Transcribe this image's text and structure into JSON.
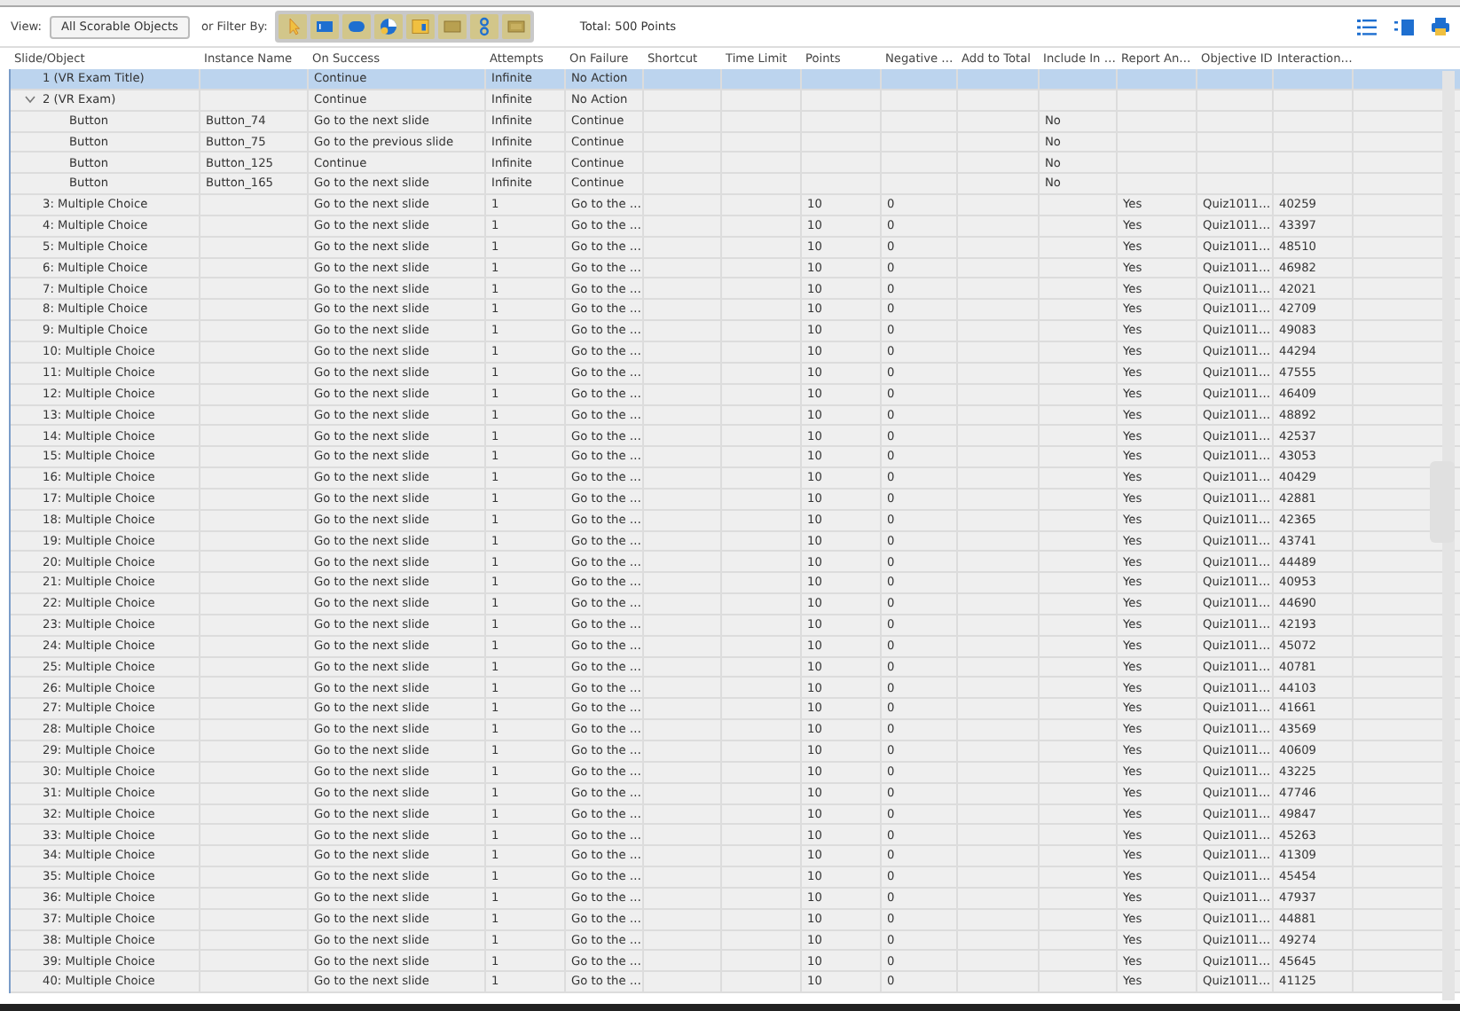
{
  "toolbar": {
    "view_label": "View:",
    "view_button": "All Scorable Objects",
    "filter_label": "or Filter By:",
    "filters": [
      {
        "kind": "cursor"
      },
      {
        "kind": "textbox"
      },
      {
        "kind": "button"
      },
      {
        "kind": "rollover"
      },
      {
        "kind": "question"
      },
      {
        "kind": "panel"
      },
      {
        "kind": "chain"
      },
      {
        "kind": "box"
      }
    ],
    "total": "Total: 500 Points"
  },
  "table": {
    "columns": [
      "Slide/Object",
      "Instance Name",
      "On Success",
      "Attempts",
      "On Failure",
      "Shortcut",
      "Time Limit",
      "Points",
      "Negative …",
      "Add to Total",
      "Include In …",
      "Report An…",
      "Objective ID",
      "Interaction…"
    ],
    "rows": [
      {
        "slide": "1 (VR Exam Title)",
        "on_success": "Continue",
        "attempts": "Infinite",
        "on_failure": "No Action",
        "selected": true
      },
      {
        "slide": "2 (VR Exam)",
        "on_success": "Continue",
        "attempts": "Infinite",
        "on_failure": "No Action",
        "selected": false,
        "expanded": true,
        "children": [
          {
            "slide": "Button",
            "instance": "Button_74",
            "on_success": "Go to the next slide",
            "attempts": "Infinite",
            "on_failure": "Continue",
            "include_in": "No",
            "selected": false
          },
          {
            "slide": "Button",
            "instance": "Button_75",
            "on_success": "Go to the previous slide",
            "attempts": "Infinite",
            "on_failure": "Continue",
            "include_in": "No",
            "selected": false
          },
          {
            "slide": "Button",
            "instance": "Button_125",
            "on_success": "Continue",
            "attempts": "Infinite",
            "on_failure": "Continue",
            "include_in": "No",
            "selected": false
          },
          {
            "slide": "Button",
            "instance": "Button_165",
            "on_success": "Go to the next slide",
            "attempts": "Infinite",
            "on_failure": "Continue",
            "include_in": "No",
            "selected": false
          }
        ]
      },
      {
        "slide": "3: Multiple Choice",
        "on_success": "Go to the next slide",
        "attempts": "1",
        "on_failure": "Go to the …",
        "points": "10",
        "negative": "0",
        "report": "Yes",
        "objective": "Quiz1011…",
        "interaction": "40259",
        "selected": false
      },
      {
        "slide": "4: Multiple Choice",
        "on_success": "Go to the next slide",
        "attempts": "1",
        "on_failure": "Go to the …",
        "points": "10",
        "negative": "0",
        "report": "Yes",
        "objective": "Quiz1011…",
        "interaction": "43397",
        "selected": false
      },
      {
        "slide": "5: Multiple Choice",
        "on_success": "Go to the next slide",
        "attempts": "1",
        "on_failure": "Go to the …",
        "points": "10",
        "negative": "0",
        "report": "Yes",
        "objective": "Quiz1011…",
        "interaction": "48510",
        "selected": false
      },
      {
        "slide": "6: Multiple Choice",
        "on_success": "Go to the next slide",
        "attempts": "1",
        "on_failure": "Go to the …",
        "points": "10",
        "negative": "0",
        "report": "Yes",
        "objective": "Quiz1011…",
        "interaction": "46982",
        "selected": false
      },
      {
        "slide": "7: Multiple Choice",
        "on_success": "Go to the next slide",
        "attempts": "1",
        "on_failure": "Go to the …",
        "points": "10",
        "negative": "0",
        "report": "Yes",
        "objective": "Quiz1011…",
        "interaction": "42021",
        "selected": false
      },
      {
        "slide": "8: Multiple Choice",
        "on_success": "Go to the next slide",
        "attempts": "1",
        "on_failure": "Go to the …",
        "points": "10",
        "negative": "0",
        "report": "Yes",
        "objective": "Quiz1011…",
        "interaction": "42709",
        "selected": false
      },
      {
        "slide": "9: Multiple Choice",
        "on_success": "Go to the next slide",
        "attempts": "1",
        "on_failure": "Go to the …",
        "points": "10",
        "negative": "0",
        "report": "Yes",
        "objective": "Quiz1011…",
        "interaction": "49083",
        "selected": false
      },
      {
        "slide": "10: Multiple Choice",
        "on_success": "Go to the next slide",
        "attempts": "1",
        "on_failure": "Go to the …",
        "points": "10",
        "negative": "0",
        "report": "Yes",
        "objective": "Quiz1011…",
        "interaction": "44294",
        "selected": false
      },
      {
        "slide": "11: Multiple Choice",
        "on_success": "Go to the next slide",
        "attempts": "1",
        "on_failure": "Go to the …",
        "points": "10",
        "negative": "0",
        "report": "Yes",
        "objective": "Quiz1011…",
        "interaction": "47555",
        "selected": false
      },
      {
        "slide": "12: Multiple Choice",
        "on_success": "Go to the next slide",
        "attempts": "1",
        "on_failure": "Go to the …",
        "points": "10",
        "negative": "0",
        "report": "Yes",
        "objective": "Quiz1011…",
        "interaction": "46409",
        "selected": false
      },
      {
        "slide": "13: Multiple Choice",
        "on_success": "Go to the next slide",
        "attempts": "1",
        "on_failure": "Go to the …",
        "points": "10",
        "negative": "0",
        "report": "Yes",
        "objective": "Quiz1011…",
        "interaction": "48892",
        "selected": false
      },
      {
        "slide": "14: Multiple Choice",
        "on_success": "Go to the next slide",
        "attempts": "1",
        "on_failure": "Go to the …",
        "points": "10",
        "negative": "0",
        "report": "Yes",
        "objective": "Quiz1011…",
        "interaction": "42537",
        "selected": false
      },
      {
        "slide": "15: Multiple Choice",
        "on_success": "Go to the next slide",
        "attempts": "1",
        "on_failure": "Go to the …",
        "points": "10",
        "negative": "0",
        "report": "Yes",
        "objective": "Quiz1011…",
        "interaction": "43053",
        "selected": false
      },
      {
        "slide": "16: Multiple Choice",
        "on_success": "Go to the next slide",
        "attempts": "1",
        "on_failure": "Go to the …",
        "points": "10",
        "negative": "0",
        "report": "Yes",
        "objective": "Quiz1011…",
        "interaction": "40429",
        "selected": false
      },
      {
        "slide": "17: Multiple Choice",
        "on_success": "Go to the next slide",
        "attempts": "1",
        "on_failure": "Go to the …",
        "points": "10",
        "negative": "0",
        "report": "Yes",
        "objective": "Quiz1011…",
        "interaction": "42881",
        "selected": false
      },
      {
        "slide": "18: Multiple Choice",
        "on_success": "Go to the next slide",
        "attempts": "1",
        "on_failure": "Go to the …",
        "points": "10",
        "negative": "0",
        "report": "Yes",
        "objective": "Quiz1011…",
        "interaction": "42365",
        "selected": false
      },
      {
        "slide": "19: Multiple Choice",
        "on_success": "Go to the next slide",
        "attempts": "1",
        "on_failure": "Go to the …",
        "points": "10",
        "negative": "0",
        "report": "Yes",
        "objective": "Quiz1011…",
        "interaction": "43741",
        "selected": false
      },
      {
        "slide": "20: Multiple Choice",
        "on_success": "Go to the next slide",
        "attempts": "1",
        "on_failure": "Go to the …",
        "points": "10",
        "negative": "0",
        "report": "Yes",
        "objective": "Quiz1011…",
        "interaction": "44489",
        "selected": false
      },
      {
        "slide": "21: Multiple Choice",
        "on_success": "Go to the next slide",
        "attempts": "1",
        "on_failure": "Go to the …",
        "points": "10",
        "negative": "0",
        "report": "Yes",
        "objective": "Quiz1011…",
        "interaction": "40953",
        "selected": false
      },
      {
        "slide": "22: Multiple Choice",
        "on_success": "Go to the next slide",
        "attempts": "1",
        "on_failure": "Go to the …",
        "points": "10",
        "negative": "0",
        "report": "Yes",
        "objective": "Quiz1011…",
        "interaction": "44690",
        "selected": false
      },
      {
        "slide": "23: Multiple Choice",
        "on_success": "Go to the next slide",
        "attempts": "1",
        "on_failure": "Go to the …",
        "points": "10",
        "negative": "0",
        "report": "Yes",
        "objective": "Quiz1011…",
        "interaction": "42193",
        "selected": false
      },
      {
        "slide": "24: Multiple Choice",
        "on_success": "Go to the next slide",
        "attempts": "1",
        "on_failure": "Go to the …",
        "points": "10",
        "negative": "0",
        "report": "Yes",
        "objective": "Quiz1011…",
        "interaction": "45072",
        "selected": false
      },
      {
        "slide": "25: Multiple Choice",
        "on_success": "Go to the next slide",
        "attempts": "1",
        "on_failure": "Go to the …",
        "points": "10",
        "negative": "0",
        "report": "Yes",
        "objective": "Quiz1011…",
        "interaction": "40781",
        "selected": false
      },
      {
        "slide": "26: Multiple Choice",
        "on_success": "Go to the next slide",
        "attempts": "1",
        "on_failure": "Go to the …",
        "points": "10",
        "negative": "0",
        "report": "Yes",
        "objective": "Quiz1011…",
        "interaction": "44103",
        "selected": false
      },
      {
        "slide": "27: Multiple Choice",
        "on_success": "Go to the next slide",
        "attempts": "1",
        "on_failure": "Go to the …",
        "points": "10",
        "negative": "0",
        "report": "Yes",
        "objective": "Quiz1011…",
        "interaction": "41661",
        "selected": false
      },
      {
        "slide": "28: Multiple Choice",
        "on_success": "Go to the next slide",
        "attempts": "1",
        "on_failure": "Go to the …",
        "points": "10",
        "negative": "0",
        "report": "Yes",
        "objective": "Quiz1011…",
        "interaction": "43569",
        "selected": false
      },
      {
        "slide": "29: Multiple Choice",
        "on_success": "Go to the next slide",
        "attempts": "1",
        "on_failure": "Go to the …",
        "points": "10",
        "negative": "0",
        "report": "Yes",
        "objective": "Quiz1011…",
        "interaction": "40609",
        "selected": false
      },
      {
        "slide": "30: Multiple Choice",
        "on_success": "Go to the next slide",
        "attempts": "1",
        "on_failure": "Go to the …",
        "points": "10",
        "negative": "0",
        "report": "Yes",
        "objective": "Quiz1011…",
        "interaction": "43225",
        "selected": false
      },
      {
        "slide": "31: Multiple Choice",
        "on_success": "Go to the next slide",
        "attempts": "1",
        "on_failure": "Go to the …",
        "points": "10",
        "negative": "0",
        "report": "Yes",
        "objective": "Quiz1011…",
        "interaction": "47746",
        "selected": false
      },
      {
        "slide": "32: Multiple Choice",
        "on_success": "Go to the next slide",
        "attempts": "1",
        "on_failure": "Go to the …",
        "points": "10",
        "negative": "0",
        "report": "Yes",
        "objective": "Quiz1011…",
        "interaction": "49847",
        "selected": false
      },
      {
        "slide": "33: Multiple Choice",
        "on_success": "Go to the next slide",
        "attempts": "1",
        "on_failure": "Go to the …",
        "points": "10",
        "negative": "0",
        "report": "Yes",
        "objective": "Quiz1011…",
        "interaction": "45263",
        "selected": false
      },
      {
        "slide": "34: Multiple Choice",
        "on_success": "Go to the next slide",
        "attempts": "1",
        "on_failure": "Go to the …",
        "points": "10",
        "negative": "0",
        "report": "Yes",
        "objective": "Quiz1011…",
        "interaction": "41309",
        "selected": false
      },
      {
        "slide": "35: Multiple Choice",
        "on_success": "Go to the next slide",
        "attempts": "1",
        "on_failure": "Go to the …",
        "points": "10",
        "negative": "0",
        "report": "Yes",
        "objective": "Quiz1011…",
        "interaction": "45454",
        "selected": false
      },
      {
        "slide": "36: Multiple Choice",
        "on_success": "Go to the next slide",
        "attempts": "1",
        "on_failure": "Go to the …",
        "points": "10",
        "negative": "0",
        "report": "Yes",
        "objective": "Quiz1011…",
        "interaction": "47937",
        "selected": false
      },
      {
        "slide": "37: Multiple Choice",
        "on_success": "Go to the next slide",
        "attempts": "1",
        "on_failure": "Go to the …",
        "points": "10",
        "negative": "0",
        "report": "Yes",
        "objective": "Quiz1011…",
        "interaction": "44881",
        "selected": false
      },
      {
        "slide": "38: Multiple Choice",
        "on_success": "Go to the next slide",
        "attempts": "1",
        "on_failure": "Go to the …",
        "points": "10",
        "negative": "0",
        "report": "Yes",
        "objective": "Quiz1011…",
        "interaction": "49274",
        "selected": false
      },
      {
        "slide": "39: Multiple Choice",
        "on_success": "Go to the next slide",
        "attempts": "1",
        "on_failure": "Go to the …",
        "points": "10",
        "negative": "0",
        "report": "Yes",
        "objective": "Quiz1011…",
        "interaction": "45645",
        "selected": false
      },
      {
        "slide": "40: Multiple Choice",
        "on_success": "Go to the next slide",
        "attempts": "1",
        "on_failure": "Go to the …",
        "points": "10",
        "negative": "0",
        "report": "Yes",
        "objective": "Quiz1011…",
        "interaction": "41125",
        "selected": false
      }
    ]
  }
}
